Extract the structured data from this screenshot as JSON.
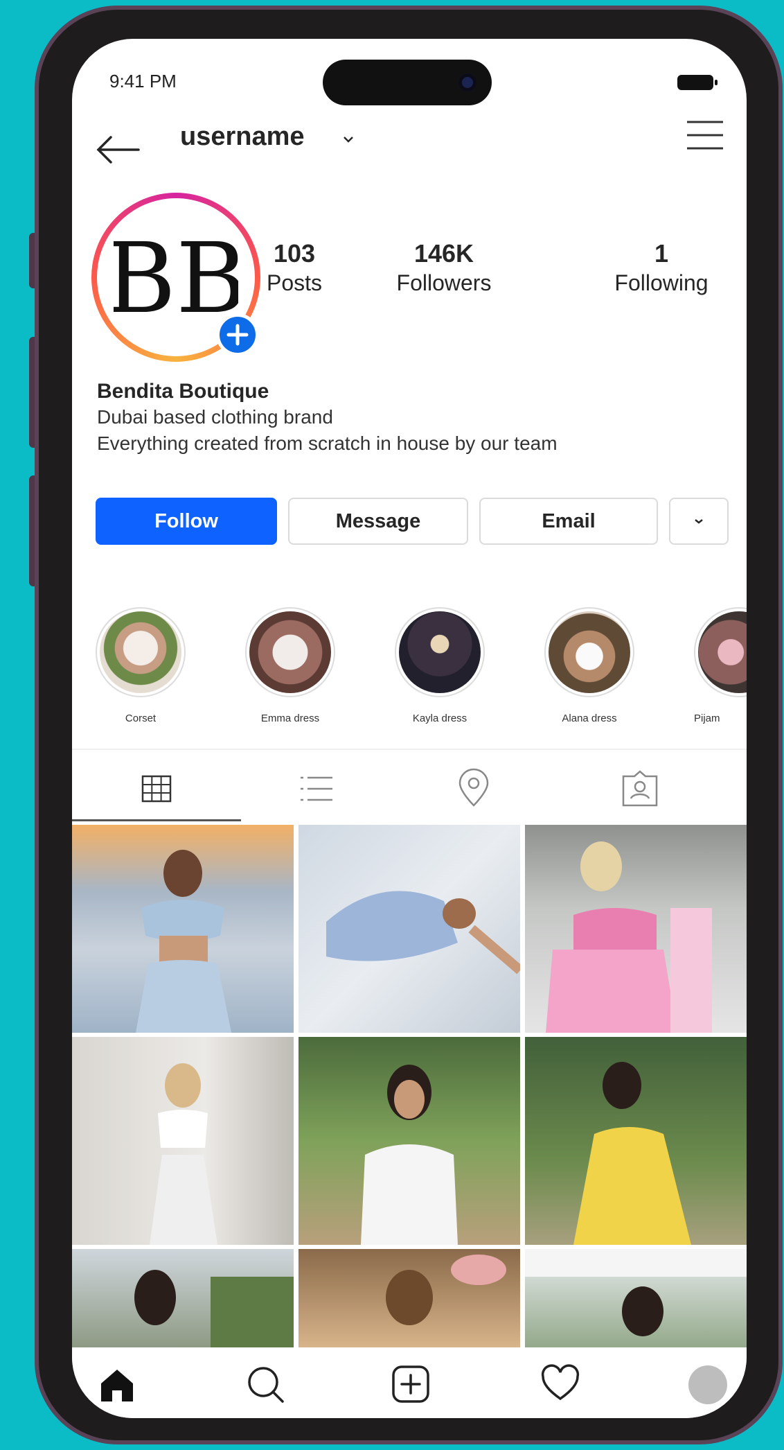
{
  "status_bar": {
    "time": "9:41 PM"
  },
  "header": {
    "username": "username"
  },
  "profile": {
    "logo_text": "BB",
    "stats": [
      {
        "value": "103",
        "label": "Posts"
      },
      {
        "value": "146K",
        "label": "Followers"
      },
      {
        "value": "1",
        "label": "Following"
      }
    ],
    "name": "Bendita Boutique",
    "bio": [
      "Dubai based clothing brand",
      "Everything created from scratch in house by our team"
    ]
  },
  "actions": {
    "follow": "Follow",
    "message": "Message",
    "email": "Email"
  },
  "highlights": [
    {
      "label": "Corset"
    },
    {
      "label": "Emma dress"
    },
    {
      "label": "Kayla dress"
    },
    {
      "label": "Alana dress"
    },
    {
      "label": "Pijam"
    }
  ],
  "tabs": [
    "grid-icon",
    "list-icon",
    "location-pin-icon",
    "tagged-icon"
  ],
  "posts_count_visible": 9,
  "bottom_nav": [
    "home-icon",
    "search-icon",
    "new-post-icon",
    "heart-icon",
    "profile-avatar"
  ],
  "colors": {
    "accent": "#0e62ff",
    "background": "#0bbcc6",
    "phone_frame": "#5a4257"
  }
}
